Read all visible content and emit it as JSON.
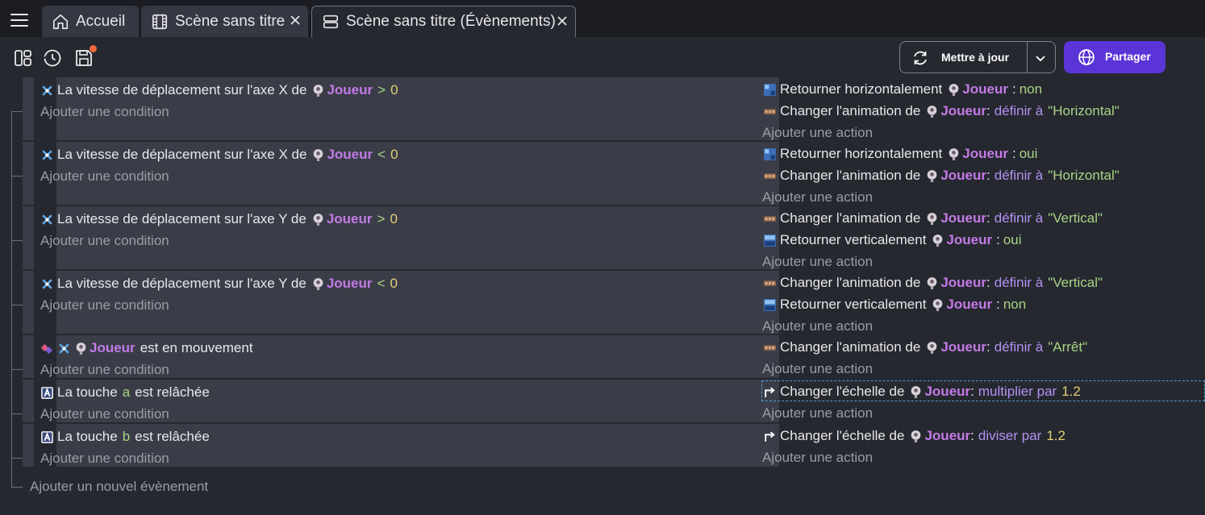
{
  "tabs": [
    {
      "label": "Accueil",
      "icon": "home-icon"
    },
    {
      "label": "Scène sans titre",
      "icon": "film-icon"
    },
    {
      "label": "Scène sans titre (Évènements)",
      "icon": "events-icon"
    }
  ],
  "toolbar": {
    "update_label": "Mettre à jour",
    "share_label": "Partager",
    "accent_color": "#5b34d8",
    "notification_color": "#f0683a"
  },
  "events": [
    {
      "conditions": [
        {
          "text": "La vitesse de déplacement sur l'axe X de",
          "object": "Joueur",
          "op": ">",
          "value": "0"
        }
      ],
      "condition_placeholder": "Ajouter une condition",
      "actions": [
        {
          "text": "Retourner horizontalement",
          "object": "Joueur",
          "suffix": ":",
          "kw": "",
          "value": "non",
          "icon": "flip-h-icon"
        },
        {
          "text": "Changer l'animation de",
          "object": "Joueur",
          "suffix": ":",
          "kw": "définir à",
          "value": "\"Horizontal\"",
          "icon": "animation-icon"
        }
      ],
      "action_placeholder": "Ajouter une action"
    },
    {
      "conditions": [
        {
          "text": "La vitesse de déplacement sur l'axe X de",
          "object": "Joueur",
          "op": "<",
          "value": "0"
        }
      ],
      "condition_placeholder": "Ajouter une condition",
      "actions": [
        {
          "text": "Retourner horizontalement",
          "object": "Joueur",
          "suffix": ":",
          "kw": "",
          "value": "oui",
          "icon": "flip-h-icon"
        },
        {
          "text": "Changer l'animation de",
          "object": "Joueur",
          "suffix": ":",
          "kw": "définir à",
          "value": "\"Horizontal\"",
          "icon": "animation-icon"
        }
      ],
      "action_placeholder": "Ajouter une action"
    },
    {
      "conditions": [
        {
          "text": "La vitesse de déplacement sur l'axe Y de",
          "object": "Joueur",
          "op": ">",
          "value": "0"
        }
      ],
      "condition_placeholder": "Ajouter une condition",
      "actions": [
        {
          "text": "Changer l'animation de",
          "object": "Joueur",
          "suffix": ":",
          "kw": "définir à",
          "value": "\"Vertical\"",
          "icon": "animation-icon"
        },
        {
          "text": "Retourner verticalement",
          "object": "Joueur",
          "suffix": ":",
          "kw": "",
          "value": "oui",
          "icon": "flip-v-icon"
        }
      ],
      "action_placeholder": "Ajouter une action"
    },
    {
      "conditions": [
        {
          "text": "La vitesse de déplacement sur l'axe Y de",
          "object": "Joueur",
          "op": "<",
          "value": "0"
        }
      ],
      "condition_placeholder": "Ajouter une condition",
      "actions": [
        {
          "text": "Changer l'animation de",
          "object": "Joueur",
          "suffix": ":",
          "kw": "définir à",
          "value": "\"Vertical\"",
          "icon": "animation-icon"
        },
        {
          "text": "Retourner verticalement",
          "object": "Joueur",
          "suffix": ":",
          "kw": "",
          "value": "non",
          "icon": "flip-v-icon"
        }
      ],
      "action_placeholder": "Ajouter une action"
    },
    {
      "conditions": [
        {
          "object": "Joueur",
          "text": "est en mouvement"
        }
      ],
      "condition_placeholder": "Ajouter une condition",
      "actions": [
        {
          "text": "Changer l'animation de",
          "object": "Joueur",
          "suffix": ":",
          "kw": "définir à",
          "value": "\"Arrêt\"",
          "icon": "animation-icon"
        }
      ],
      "action_placeholder": "Ajouter une action"
    },
    {
      "conditions": [
        {
          "text": "La touche",
          "key": "a",
          "text2": "est relâchée"
        }
      ],
      "condition_placeholder": "Ajouter une condition",
      "actions": [
        {
          "text": "Changer l'échelle de",
          "object": "Joueur",
          "suffix": ":",
          "kw": "multiplier par",
          "value": "1.2",
          "icon": "scale-icon"
        }
      ],
      "action_placeholder": "Ajouter une action"
    },
    {
      "conditions": [
        {
          "text": "La touche",
          "key": "b",
          "text2": "est relâchée"
        }
      ],
      "condition_placeholder": "Ajouter une condition",
      "actions": [
        {
          "text": "Changer l'échelle de",
          "object": "Joueur",
          "suffix": ":",
          "kw": "diviser par",
          "value": "1.2",
          "icon": "scale-icon"
        }
      ],
      "action_placeholder": "Ajouter une action"
    }
  ],
  "add_event_label": "Ajouter un nouvel évènement"
}
